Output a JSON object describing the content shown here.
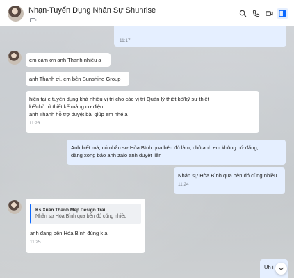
{
  "header": {
    "title": "Nhạn-Tuyển Dụng Nhân Sự Shunrise",
    "actions": [
      "search-icon",
      "phone-icon",
      "video-icon",
      "sidebar-toggle-icon"
    ]
  },
  "colors": {
    "accent": "#0a68ff",
    "outgoing_bubble": "#e5efff",
    "incoming_bubble": "#ffffff"
  },
  "messages": [
    {
      "dir": "out",
      "text": "",
      "time": "11:17"
    },
    {
      "dir": "in",
      "text": "em cảm ơn anh Thanh  nhiều a",
      "time": ""
    },
    {
      "dir": "in",
      "text": "anh Thanh ơi, em bên Sunshine Group",
      "time": ""
    },
    {
      "dir": "in",
      "lines": [
        "hiện tại e tuyển dụng khá nhiều vị trí cho các vị trí Quản lý thiết kế/kỹ sư thiết",
        "kế/chủ trì thiết kế mảng cơ điện",
        "anh Thanh hỗ trợ duyệt bài giúp em nhé ạ"
      ],
      "time": "11:23"
    },
    {
      "dir": "out",
      "lines": [
        "Anh biết mà, có nhân sự Hòa Bình qua bên đó làm, chỗ anh em không cứ đăng,",
        "đăng xong báo anh zalo anh duyệt liền"
      ],
      "time": ""
    },
    {
      "dir": "out",
      "text": "Nhân sự Hòa Bình qua bên đó cũng nhiều",
      "time": "11:24"
    },
    {
      "dir": "in",
      "quote": {
        "name": "Ks Xuân Thanh Mep Design Trai...",
        "text": "Nhân sự Hòa Bình qua bên đó cũng nhiều"
      },
      "text": "anh đang bên Hòa Bình đúng k ạ",
      "time": "11:25"
    },
    {
      "dir": "out",
      "text": "Uh i",
      "time": ""
    }
  ]
}
